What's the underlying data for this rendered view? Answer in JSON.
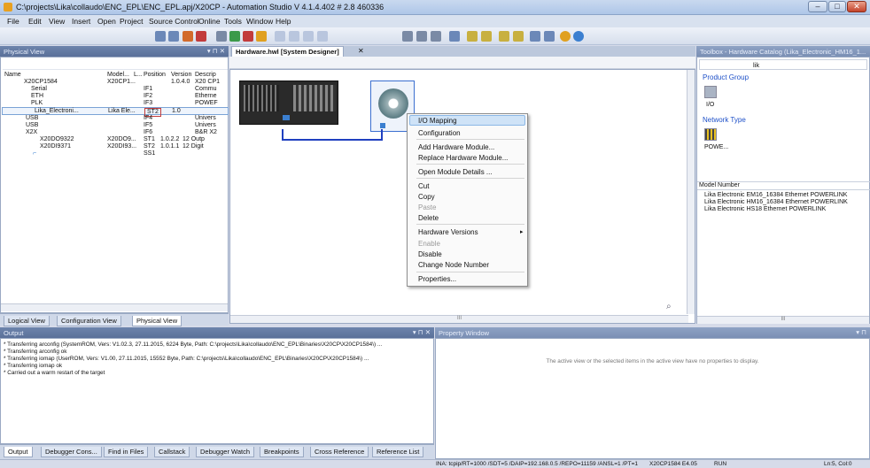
{
  "window": {
    "title": "C:\\projects\\Lika\\collaudo\\ENC_EPL\\ENC_EPL.apj/X20CP - Automation Studio V 4.1.4.402 # 2.8 460336",
    "minimize": "–",
    "maximize": "□",
    "close": "✕"
  },
  "menu": [
    "File",
    "Edit",
    "View",
    "Insert",
    "Open",
    "Project",
    "Source Control",
    "Online",
    "Tools",
    "Window",
    "Help"
  ],
  "physical_view": {
    "title": "Physical View",
    "controls": "▾ ⊓ ✕",
    "columns": [
      "Name",
      "Model...",
      "L...",
      "Position",
      "Version",
      "Descrip"
    ],
    "rows": [
      {
        "name": "X20CP1584",
        "model": "X20CP1...",
        "pos": "",
        "ver": "1.0.4.0",
        "desc": "X20 CP1"
      },
      {
        "name": "Serial",
        "model": "",
        "pos": "IF1",
        "ver": "",
        "desc": "Commu"
      },
      {
        "name": "ETH",
        "model": "",
        "pos": "IF2",
        "ver": "",
        "desc": "Etherne"
      },
      {
        "name": "PLK",
        "model": "",
        "pos": "IF3",
        "ver": "",
        "desc": "POWEF"
      },
      {
        "name": "Lika_Electroni...",
        "model": "Lika Ele...",
        "pos": "ST2",
        "ver": "1.0",
        "desc": ""
      },
      {
        "name": "USB",
        "model": "",
        "pos": "IF4",
        "ver": "",
        "desc": "Univers"
      },
      {
        "name": "USB",
        "model": "",
        "pos": "IF5",
        "ver": "",
        "desc": "Univers"
      },
      {
        "name": "X2X",
        "model": "",
        "pos": "IF6",
        "ver": "",
        "desc": "B&R X2"
      },
      {
        "name": "X20DO9322",
        "model": "X20DO9...",
        "pos": "ST1",
        "ver": "1.0.2.2",
        "desc": "12 Outp"
      },
      {
        "name": "X20DI9371",
        "model": "X20DI93...",
        "pos": "ST2",
        "ver": "1.0.1.1",
        "desc": "12 Digit"
      },
      {
        "name": "",
        "model": "",
        "pos": "SS1",
        "ver": "",
        "desc": ""
      }
    ],
    "tabs": [
      "Logical View",
      "Configuration View",
      "Physical View"
    ]
  },
  "designer": {
    "tab_label": "Hardware.hwl [System Designer]",
    "scroll_label": "III"
  },
  "context_menu": {
    "items": [
      {
        "label": "I/O Mapping",
        "disabled": false
      },
      {
        "label": "Configuration",
        "disabled": false
      },
      {
        "label": "Add Hardware Module...",
        "disabled": false
      },
      {
        "label": "Replace Hardware Module...",
        "disabled": false
      },
      {
        "label": "Open Module Details ...",
        "disabled": false
      },
      {
        "label": "Cut",
        "disabled": false
      },
      {
        "label": "Copy",
        "disabled": false
      },
      {
        "label": "Paste",
        "disabled": true
      },
      {
        "label": "Delete",
        "disabled": false
      },
      {
        "label": "Hardware Versions",
        "disabled": false
      },
      {
        "label": "Enable",
        "disabled": true
      },
      {
        "label": "Disable",
        "disabled": false
      },
      {
        "label": "Change Node Number",
        "disabled": false
      },
      {
        "label": "Properties...",
        "disabled": false
      }
    ],
    "submenu_arrow": "▸"
  },
  "toolbox": {
    "title": "Toolbox - Hardware Catalog (Lika_Electronic_HM16_1...",
    "search_value": "lik",
    "product_group_label": "Product Group",
    "product_group_item": "I/O",
    "network_type_label": "Network Type",
    "network_type_item": "POWE...",
    "model_number_header": "Model Number",
    "models": [
      "Lika Electronic EM16_16384 Ethernet POWERLINK",
      "Lika Electronic HM16_16384 Ethernet POWERLINK",
      "Lika Electronic HS18 Ethernet POWERLINK"
    ],
    "scroll_label": "III"
  },
  "output": {
    "title": "Output",
    "controls": "▾ ⊓ ✕",
    "lines": [
      "* Transferring arconfig (SystemROM, Vers: V1.02.3, 27.11.2015, 6224 Byte, Path: C:\\projects\\Lika\\collaudo\\ENC_EPL\\Binaries\\X20CP\\X20CP1584\\) ...",
      "* Transferring arconfig ok",
      "* Transferring iomap (UserROM, Vers: V1.00, 27.11.2015, 15552 Byte, Path: C:\\projects\\Lika\\collaudo\\ENC_EPL\\Binaries\\X20CP\\X20CP1584\\) ...",
      "* Transferring iomap ok",
      "* Carried out a warm restart of the target"
    ],
    "tabs": [
      "Output",
      "Debugger Cons...",
      "Find in Files",
      "Callstack",
      "Debugger Watch",
      "Breakpoints",
      "Cross Reference",
      "Reference List"
    ]
  },
  "property_window": {
    "title": "Property Window",
    "controls": "▾ ⊓",
    "message": "The active view or the selected items in the active view have no properties to display."
  },
  "status": {
    "connection": "INA: tcpip/RT=1000 /SDT=5 /DAIP=192.168.0.5 /REPO=11159 /ANSL=1 /PT=1",
    "target": "X20CP1584 E4.05",
    "mode": "RUN",
    "cursor": "Ln:5, Col:0"
  },
  "colors": {
    "accent": "#5a7099",
    "link": "#1e50c8",
    "highlight": "#cfe3f7"
  }
}
